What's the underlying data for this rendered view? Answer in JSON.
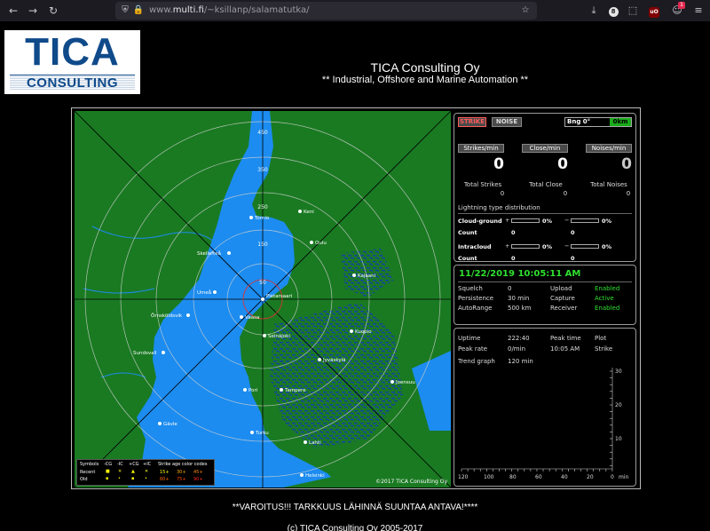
{
  "browser": {
    "url_prefix": "www.",
    "url_domain": "multi.fi",
    "url_path": "/~ksillanp/salamatutka/",
    "badge": "1",
    "ext_label": "8",
    "ub_label": "uO"
  },
  "header": {
    "logo_top": "TICA",
    "logo_bottom": "CONSULTING",
    "company": "TICA Consulting Oy",
    "tagline": "** Industrial, Offshore and Marine Automation **"
  },
  "map": {
    "range_labels": [
      "50",
      "150",
      "250",
      "350",
      "450"
    ],
    "cities": [
      "Keni",
      "Tornio",
      "Oulu",
      "Skellefteå",
      "Kajaani",
      "Umeå",
      "Pietarsaari",
      "Örnsköldsvik",
      "Vaasa",
      "Seinäjoki",
      "Kuopio",
      "Jyväskylä",
      "Sundsvall",
      "Pori",
      "Tampere",
      "Joensuu",
      "Gävle",
      "Turku",
      "Helsinki",
      "Lahti"
    ],
    "copyright": "©2017 TICA Consulting Oy",
    "legend": {
      "symbols_label": "Symbols",
      "sym_cols": [
        "-CG",
        "-IC",
        "+CG",
        "+IC"
      ],
      "recent_label": "Recent",
      "old_label": "Old",
      "age_title": "Strike age color codes",
      "age_recent": [
        "15+",
        "30+",
        "45+"
      ],
      "age_old": [
        "60+",
        "75+",
        "90+"
      ]
    }
  },
  "stats": {
    "strike_btn": "STRIKE",
    "noise_btn": "NOISE",
    "bng_label": "Bng 0°",
    "bng_value": "0km",
    "strikes_min_label": "Strikes/min",
    "close_min_label": "Close/min",
    "noises_min_label": "Noises/min",
    "strikes_min": "0",
    "close_min": "0",
    "noises_min": "0",
    "total_strikes_label": "Total Strikes",
    "total_close_label": "Total Close",
    "total_noises_label": "Total Noises",
    "total_strikes": "0",
    "total_close": "0",
    "total_noises": "0",
    "ltd_title": "Lightning type distribution",
    "cg_label": "Cloud-ground",
    "ic_label": "Intracloud",
    "count_label": "Count",
    "plus": "+",
    "minus": "−",
    "pct": "0%",
    "zero": "0"
  },
  "status": {
    "datetime": "11/22/2019 10:05:11 AM",
    "squelch_label": "Squelch",
    "squelch": "0",
    "persistence_label": "Persistence",
    "persistence": "30 min",
    "autorange_label": "AutoRange",
    "autorange": "500 km",
    "upload_label": "Upload",
    "upload": "Enabled",
    "capture_label": "Capture",
    "capture": "Active",
    "receiver_label": "Receiver",
    "receiver": "Enabled"
  },
  "trend": {
    "uptime_label": "Uptime",
    "uptime": "222:40",
    "peak_time_label": "Peak time",
    "plot_label": "Plot",
    "peak_rate_label": "Peak rate",
    "peak_rate": "0/min",
    "peak_time": "10:05 AM",
    "plot": "Strike",
    "trend_graph_label": "Trend graph",
    "trend_graph": "120 min",
    "y_ticks": [
      "30",
      "20",
      "10"
    ],
    "x_ticks": [
      "120",
      "100",
      "80",
      "60",
      "40",
      "20",
      "0"
    ],
    "x_unit": "min"
  },
  "footer": {
    "warning": "**VAROITUS!!! TARKKUUS LÄHINNÄ SUUNTAA ANTAVA!****",
    "copyright": "(c) TICA Consulting Oy 2005-2017"
  }
}
